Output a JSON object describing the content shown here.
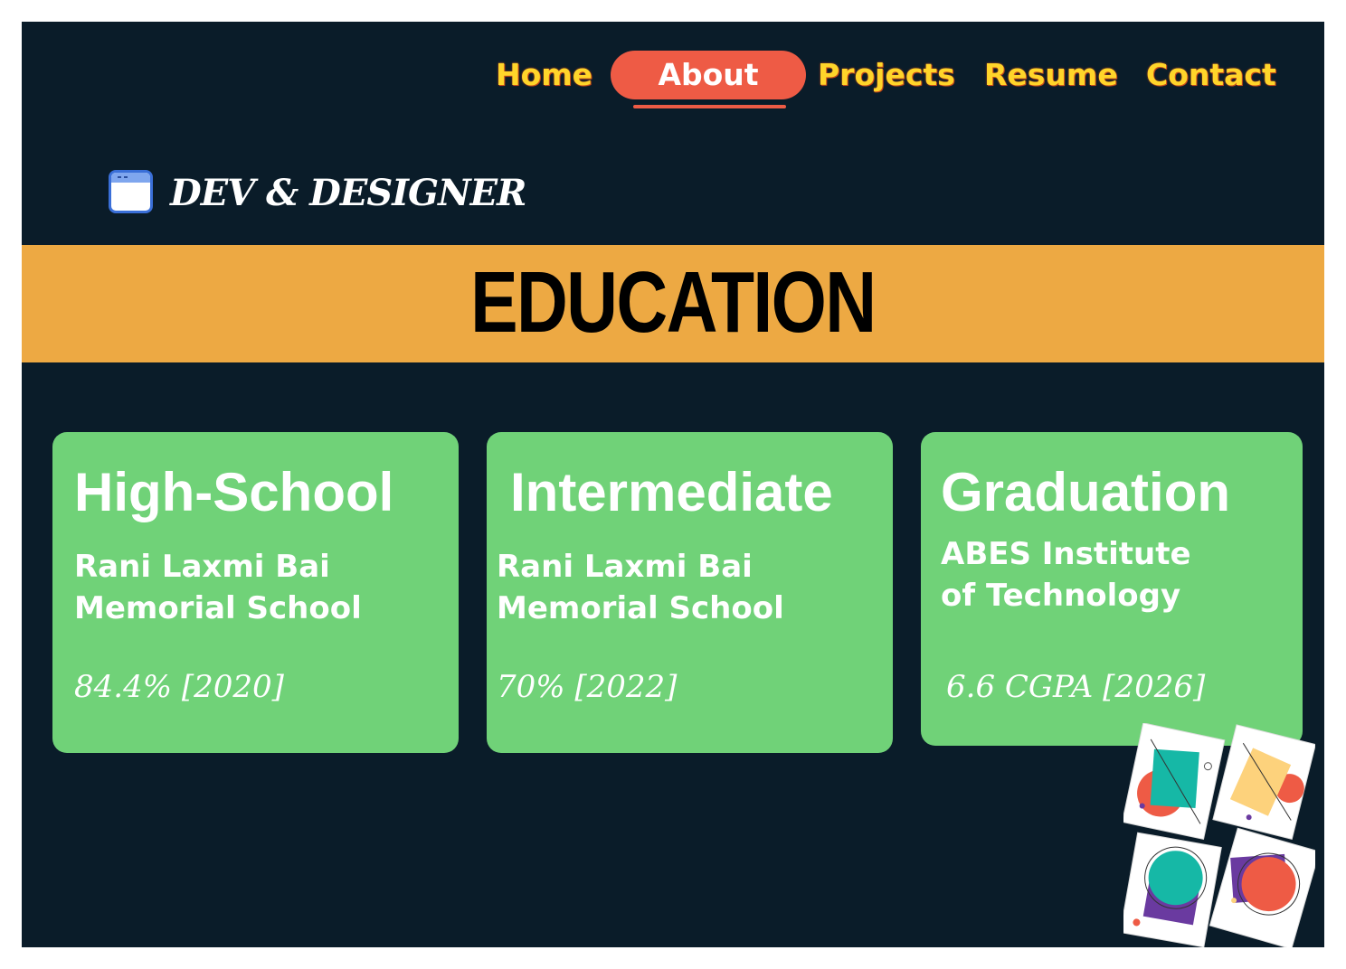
{
  "nav": {
    "items": [
      {
        "label": "Home"
      },
      {
        "label": "About"
      },
      {
        "label": "Projects"
      },
      {
        "label": "Resume"
      },
      {
        "label": "Contact"
      }
    ]
  },
  "brand": {
    "icon": "browser-window-icon",
    "text": "DEV & DESIGNER"
  },
  "banner": {
    "title": "EDUCATION"
  },
  "cards": [
    {
      "title": "High-School",
      "school_line1": "Rani Laxmi Bai",
      "school_line2": "Memorial School",
      "score": "84.4% [2020]"
    },
    {
      "title": "Intermediate",
      "school_line1": "Rani Laxmi Bai",
      "school_line2": "Memorial School",
      "score": "70% [2022]"
    },
    {
      "title": "Graduation",
      "school_line1": "ABES Institute",
      "school_line2": "of Technology",
      "score": "6.6 CGPA [2026]"
    }
  ],
  "colors": {
    "background": "#0a1c29",
    "nav_text": "#ffd52a",
    "nav_active": "#ee5b45",
    "banner": "#eda943",
    "card": "#70d278"
  }
}
